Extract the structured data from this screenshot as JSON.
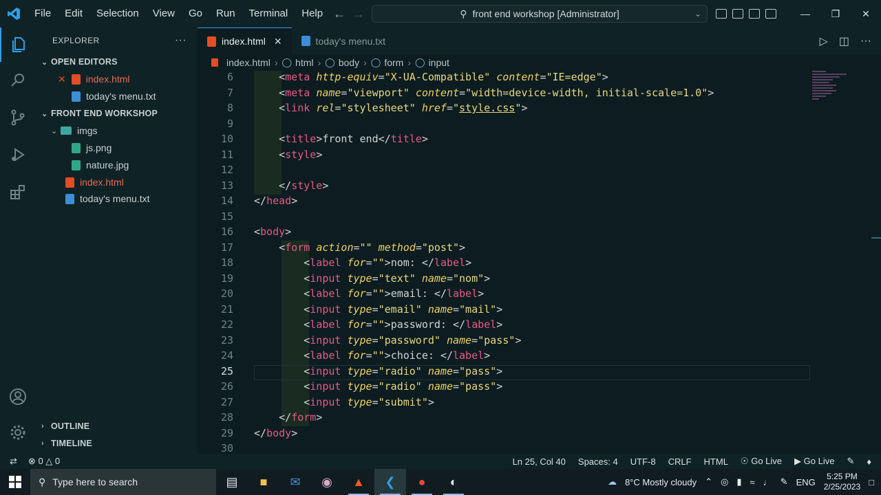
{
  "menu": [
    "File",
    "Edit",
    "Selection",
    "View",
    "Go",
    "Run",
    "Terminal",
    "Help"
  ],
  "command_center": "front end workshop [Administrator]",
  "explorer": {
    "title": "EXPLORER",
    "open_editors": "OPEN EDITORS",
    "open_files": [
      "index.html",
      "today's menu.txt"
    ],
    "workspace": "FRONT END WORKSHOP",
    "folder": "imgs",
    "folder_files": [
      "js.png",
      "nature.jpg"
    ],
    "root_files": [
      "index.html",
      "today's menu.txt"
    ],
    "outline": "OUTLINE",
    "timeline": "TIMELINE"
  },
  "tabs": [
    {
      "label": "index.html",
      "active": true
    },
    {
      "label": "today's menu.txt",
      "active": false
    }
  ],
  "breadcrumb": [
    "index.html",
    "html",
    "body",
    "form",
    "input"
  ],
  "code_lines": [
    {
      "n": "6",
      "html": "    <span class='p'>&lt;</span><span class='t'>meta</span> <span class='a'>http-equiv</span><span class='p'>=</span><span class='s'>\"X-UA-Compatible\"</span> <span class='a'>content</span><span class='p'>=</span><span class='s'>\"IE=edge\"</span><span class='p'>&gt;</span>"
    },
    {
      "n": "7",
      "html": "    <span class='p'>&lt;</span><span class='t'>meta</span> <span class='a'>name</span><span class='p'>=</span><span class='s'>\"viewport\"</span> <span class='a'>content</span><span class='p'>=</span><span class='s'>\"width=device-width, initial-scale=1.0\"</span><span class='p'>&gt;</span>"
    },
    {
      "n": "8",
      "html": "    <span class='p'>&lt;</span><span class='t'>link</span> <span class='a'>rel</span><span class='p'>=</span><span class='s'>\"stylesheet\"</span> <span class='a'>href</span><span class='p'>=</span><span class='s'>\"<span class='u'>style.css</span>\"</span><span class='p'>&gt;</span>"
    },
    {
      "n": "9",
      "html": ""
    },
    {
      "n": "10",
      "html": "    <span class='p'>&lt;</span><span class='t'>title</span><span class='p'>&gt;</span>front end<span class='p'>&lt;/</span><span class='t'>title</span><span class='p'>&gt;</span>"
    },
    {
      "n": "11",
      "html": "    <span class='p'>&lt;</span><span class='t'>style</span><span class='p'>&gt;</span>"
    },
    {
      "n": "12",
      "html": ""
    },
    {
      "n": "13",
      "html": "    <span class='p'>&lt;/</span><span class='t'>style</span><span class='p'>&gt;</span>"
    },
    {
      "n": "14",
      "html": "<span class='p'>&lt;/</span><span class='t'>head</span><span class='p'>&gt;</span>"
    },
    {
      "n": "15",
      "html": ""
    },
    {
      "n": "16",
      "html": "<span class='p'>&lt;</span><span class='t'>body</span><span class='p'>&gt;</span>"
    },
    {
      "n": "17",
      "html": "    <span class='p'>&lt;</span><span class='t'>form</span> <span class='a'>action</span><span class='p'>=</span><span class='s'>\"\"</span> <span class='a'>method</span><span class='p'>=</span><span class='s'>\"post\"</span><span class='p'>&gt;</span>"
    },
    {
      "n": "18",
      "html": "        <span class='p'>&lt;</span><span class='t'>label</span> <span class='a'>for</span><span class='p'>=</span><span class='s'>\"\"</span><span class='p'>&gt;</span>nom: <span class='p'>&lt;/</span><span class='t'>label</span><span class='p'>&gt;</span>"
    },
    {
      "n": "19",
      "html": "        <span class='p'>&lt;</span><span class='t'>input</span> <span class='a'>type</span><span class='p'>=</span><span class='s'>\"text\"</span> <span class='a'>name</span><span class='p'>=</span><span class='s'>\"nom\"</span><span class='p'>&gt;</span>"
    },
    {
      "n": "20",
      "html": "        <span class='p'>&lt;</span><span class='t'>label</span> <span class='a'>for</span><span class='p'>=</span><span class='s'>\"\"</span><span class='p'>&gt;</span>email: <span class='p'>&lt;/</span><span class='t'>label</span><span class='p'>&gt;</span>"
    },
    {
      "n": "21",
      "html": "        <span class='p'>&lt;</span><span class='t'>input</span> <span class='a'>type</span><span class='p'>=</span><span class='s'>\"email\"</span> <span class='a'>name</span><span class='p'>=</span><span class='s'>\"mail\"</span><span class='p'>&gt;</span>"
    },
    {
      "n": "22",
      "html": "        <span class='p'>&lt;</span><span class='t'>label</span> <span class='a'>for</span><span class='p'>=</span><span class='s'>\"\"</span><span class='p'>&gt;</span>password: <span class='p'>&lt;/</span><span class='t'>label</span><span class='p'>&gt;</span>"
    },
    {
      "n": "23",
      "html": "        <span class='p'>&lt;</span><span class='t'>input</span> <span class='a'>type</span><span class='p'>=</span><span class='s'>\"password\"</span> <span class='a'>name</span><span class='p'>=</span><span class='s'>\"pass\"</span><span class='p'>&gt;</span>"
    },
    {
      "n": "24",
      "html": "        <span class='p'>&lt;</span><span class='t'>label</span> <span class='a'>for</span><span class='p'>=</span><span class='s'>\"\"</span><span class='p'>&gt;</span>choice: <span class='p'>&lt;/</span><span class='t'>label</span><span class='p'>&gt;</span>"
    },
    {
      "n": "25",
      "html": "        <span class='p'>&lt;</span><span class='t'>input</span> <span class='a'>type</span><span class='p'>=</span><span class='s'>\"radio\"</span> <span class='a'>name</span><span class='p'>=</span><span class='s'>\"pass\"</span><span class='p'>&gt;</span>"
    },
    {
      "n": "26",
      "html": "        <span class='p'>&lt;</span><span class='t'>input</span> <span class='a'>type</span><span class='p'>=</span><span class='s'>\"radio\"</span> <span class='a'>name</span><span class='p'>=</span><span class='s'>\"pass\"</span><span class='p'>&gt;</span>"
    },
    {
      "n": "27",
      "html": "        <span class='p'>&lt;</span><span class='t'>input</span> <span class='a'>type</span><span class='p'>=</span><span class='s'>\"submit\"</span><span class='p'>&gt;</span>"
    },
    {
      "n": "28",
      "html": "    <span class='p'>&lt;/</span><span class='t'>form</span><span class='p'>&gt;</span>"
    },
    {
      "n": "29",
      "html": "<span class='p'>&lt;/</span><span class='t'>body</span><span class='p'>&gt;</span>"
    },
    {
      "n": "30",
      "html": ""
    }
  ],
  "current_line": "25",
  "status": {
    "errors": "0",
    "warnings": "0",
    "position": "Ln 25, Col 40",
    "spaces": "Spaces: 4",
    "encoding": "UTF-8",
    "eol": "CRLF",
    "language": "HTML",
    "golive1": "Go Live",
    "golive2": "Go Live"
  },
  "taskbar": {
    "search_placeholder": "Type here to search",
    "weather": "8°C  Mostly cloudy",
    "lang": "ENG",
    "time": "5:25 PM",
    "date": "2/25/2023"
  },
  "colors": {
    "accent": "#2f9fe8",
    "tag": "#e85a87",
    "attr": "#f0d25a",
    "string": "#e8d87a"
  }
}
